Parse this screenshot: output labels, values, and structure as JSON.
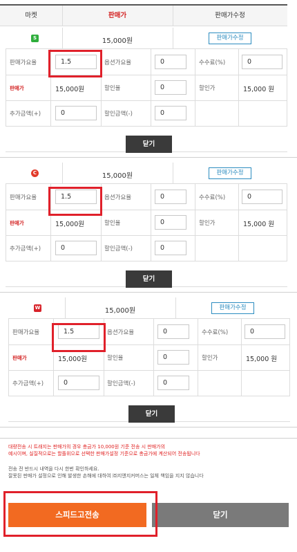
{
  "header": {
    "col_market": "마켓",
    "col_price": "판매가",
    "col_edit": "판매가수정"
  },
  "sections": [
    {
      "badge": "S",
      "badge_color": "#2fae3c",
      "badge_shape": "square",
      "price": "15,000원",
      "edit_label": "판매가수정",
      "labels": {
        "price_rate": "판매가요율",
        "option_rate": "옵션가요율",
        "fee": "수수료(%)",
        "sale_price": "판매가",
        "discount_rate": "할인율",
        "discount_price": "할인가",
        "extra_amount": "추가금액(+)",
        "discount_amount": "할인금액(-)"
      },
      "values": {
        "price_rate": "1.5",
        "option_rate": "0",
        "fee": "0",
        "sale_price": "15,000원",
        "discount_rate": "0",
        "discount_price": "15,000 원",
        "extra_amount": "0",
        "discount_amount": "0"
      },
      "close_label": "닫기"
    },
    {
      "badge": "C",
      "badge_color": "#e23a2a",
      "badge_shape": "circle",
      "price": "15,000원",
      "edit_label": "판매가수정",
      "labels": {
        "price_rate": "판매가요율",
        "option_rate": "옵션가요율",
        "fee": "수수료(%)",
        "sale_price": "판매가",
        "discount_rate": "할인율",
        "discount_price": "할인가",
        "extra_amount": "추가금액(+)",
        "discount_amount": "할인금액(-)"
      },
      "values": {
        "price_rate": "1.5",
        "option_rate": "0",
        "fee": "0",
        "sale_price": "15,000원",
        "discount_rate": "0",
        "discount_price": "15,000 원",
        "extra_amount": "0",
        "discount_amount": "0"
      },
      "close_label": "닫기"
    },
    {
      "badge": "W",
      "badge_color": "#d8232a",
      "badge_shape": "square",
      "price": "15,000원",
      "edit_label": "판매가수정",
      "labels": {
        "price_rate": "판매가요율",
        "option_rate": "옵션가요율",
        "fee": "수수료(%)",
        "sale_price": "판매가",
        "discount_rate": "할인율",
        "discount_price": "할인가",
        "extra_amount": "추가금액(+)",
        "discount_amount": "할인금액(-)"
      },
      "values": {
        "price_rate": "1.5",
        "option_rate": "0",
        "fee": "0",
        "sale_price": "15,000원",
        "discount_rate": "0",
        "discount_price": "15,000 원",
        "extra_amount": "0",
        "discount_amount": "0"
      },
      "close_label": "닫기"
    }
  ],
  "notices": {
    "red_line1": "대량전송 시 트래지는 판매가의 경우 총금가 10,000원 기준 전송 시 판매가의",
    "red_line2": "예시이며, 실질적으로는 할플위으로 선택한 판매가설정 기준으로 총금가에 계산되어 전송됩니다",
    "gray_line1": "전송 전 반드시 내역을 다시 한번 확인하세요.",
    "gray_line2": "잘못된 판매가 설정으로 인해 발생한 손해에 대하여 ㈜지앤지커머스는 일체 책임을 지지 않습니다"
  },
  "footer": {
    "send_label": "스피드고전송",
    "close_label": "닫기",
    "send_color": "#f26a21",
    "close_color": "#7a7a7a"
  }
}
